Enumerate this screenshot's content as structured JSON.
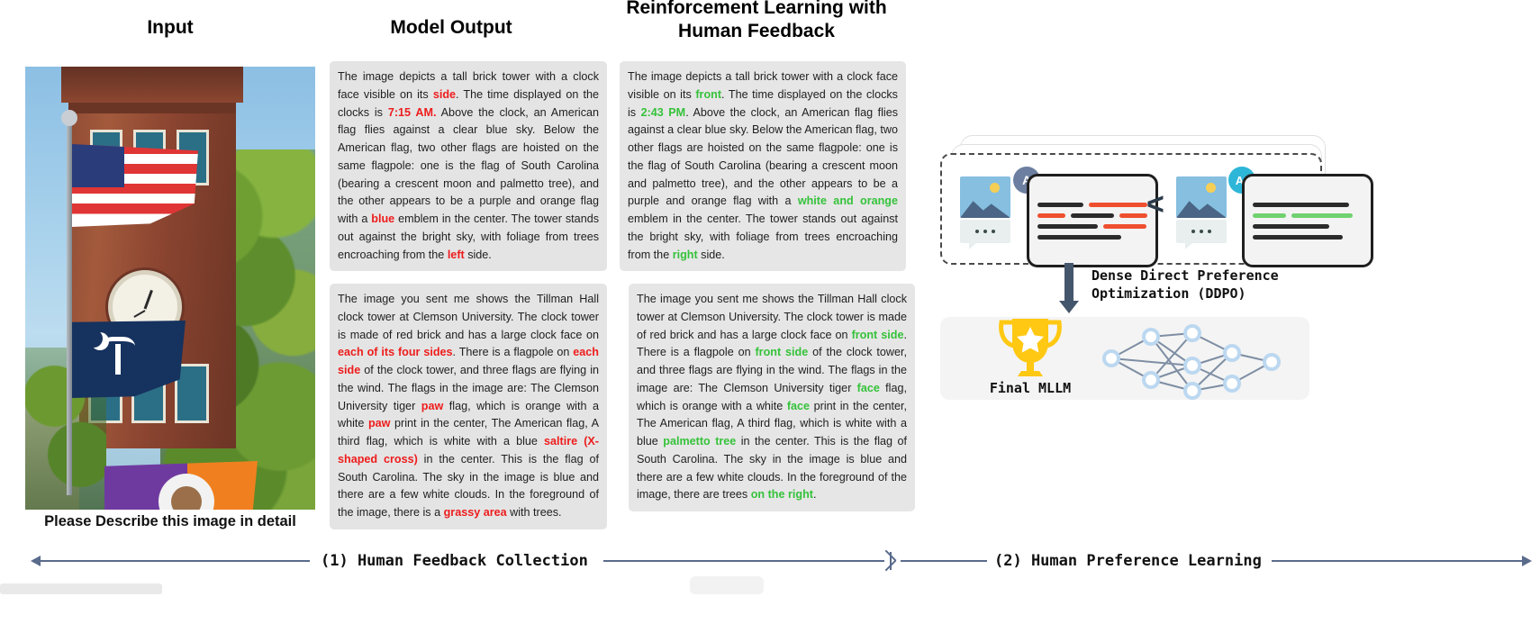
{
  "columns": {
    "input": "Input",
    "model_output": "Model Output",
    "rlhf_line1": "Reinforcement Learning with",
    "rlhf_line2": "Human Feedback"
  },
  "input_caption": "Please Describe this image in detail",
  "responses": {
    "model_output_1": [
      {
        "t": "The image depicts a tall brick tower with a clock face visible on its "
      },
      {
        "t": "side",
        "hl": "red"
      },
      {
        "t": ". The time displayed on the clocks is "
      },
      {
        "t": "7:15 AM.",
        "hl": "red"
      },
      {
        "t": "  Above the clock, an American flag flies against a clear blue sky. Below the American flag, two other flags are hoisted on the same flagpole: one is the flag of South Carolina (bearing a crescent moon and palmetto tree), and the other appears to be a purple and orange flag with a "
      },
      {
        "t": "blue",
        "hl": "red"
      },
      {
        "t": " emblem in the center. The tower stands out against the bright sky, with foliage from trees encroaching from the "
      },
      {
        "t": "left",
        "hl": "red"
      },
      {
        "t": " side."
      }
    ],
    "model_output_2": [
      {
        "t": "The image you sent me shows the Tillman Hall clock tower at Clemson University. The clock tower is made of red brick and has a large clock face on "
      },
      {
        "t": "each of its four sides",
        "hl": "red"
      },
      {
        "t": ". There is a flagpole on "
      },
      {
        "t": "each side",
        "hl": "red"
      },
      {
        "t": " of the clock tower, and three flags are flying in the wind. The flags in the image are: The Clemson University tiger "
      },
      {
        "t": "paw",
        "hl": "red"
      },
      {
        "t": " flag, which is orange with a white "
      },
      {
        "t": "paw",
        "hl": "red"
      },
      {
        "t": " print in the center, The American flag, A third flag, which is white with a blue "
      },
      {
        "t": "saltire (X-shaped cross)",
        "hl": "red"
      },
      {
        "t": " in the center. This is the flag of South Carolina. The sky in the image is blue and there are a few white clouds. In the foreground of the image, there is a "
      },
      {
        "t": "grassy area",
        "hl": "red"
      },
      {
        "t": " with trees."
      }
    ],
    "rlhf_1": [
      {
        "t": "The image depicts a tall brick tower with a clock face visible on its "
      },
      {
        "t": "front",
        "hl": "green"
      },
      {
        "t": ". The time displayed on the clocks is "
      },
      {
        "t": "2:43 PM",
        "hl": "green"
      },
      {
        "t": ".  Above the clock, an American flag flies against a clear blue sky. Below the American flag, two other flags are hoisted on the same flagpole: one is the flag of South Carolina (bearing a crescent moon and palmetto tree), and the other appears to be a purple and orange flag with a "
      },
      {
        "t": "white and orange",
        "hl": "green"
      },
      {
        "t": " emblem in the center. The tower stands out against the bright sky, with foliage from trees encroaching from the "
      },
      {
        "t": "right",
        "hl": "green"
      },
      {
        "t": " side."
      }
    ],
    "rlhf_2": [
      {
        "t": "The image you sent me shows the Tillman Hall clock tower at Clemson University. The clock tower is made of red brick and has a large clock face on "
      },
      {
        "t": "front side",
        "hl": "green"
      },
      {
        "t": ". There is a flagpole on "
      },
      {
        "t": "front side",
        "hl": "green"
      },
      {
        "t": " of the clock tower, and three flags are flying in the wind. The flags in the image are: The Clemson University tiger "
      },
      {
        "t": "face",
        "hl": "green"
      },
      {
        "t": " flag, which is orange with a white "
      },
      {
        "t": "face",
        "hl": "green"
      },
      {
        "t": " print in the center, The American flag, A third flag, which is white with a blue "
      },
      {
        "t": "palmetto tree",
        "hl": "green"
      },
      {
        "t": " in the center. This is the flag of South Carolina. The sky in the image is blue and there are a few white clouds. In the foreground of the image, there are trees "
      },
      {
        "t": "on the right",
        "hl": "green"
      },
      {
        "t": "."
      }
    ]
  },
  "diagram": {
    "badge_a": "A",
    "badge_a_star": "A*",
    "comparison_operator": "<",
    "ddpo_line1": "Dense Direct Preference",
    "ddpo_line2": "Optimization (DDPO)",
    "final_mllm": "Final MLLM"
  },
  "axes": {
    "stage1": "(1) Human Feedback Collection",
    "stage2": "(2) Human Preference Learning"
  },
  "colors": {
    "highlight_red": "#ee1c1c",
    "highlight_green": "#35c23a",
    "box_bg": "#e4e4e4",
    "axis": "#5a6b8c",
    "trophy": "#ffc813",
    "card_red_line": "#ef4f2e",
    "card_green_line": "#6fd16f",
    "badge_a": "#6d7fa0",
    "badge_a_star": "#2eb6d8"
  }
}
